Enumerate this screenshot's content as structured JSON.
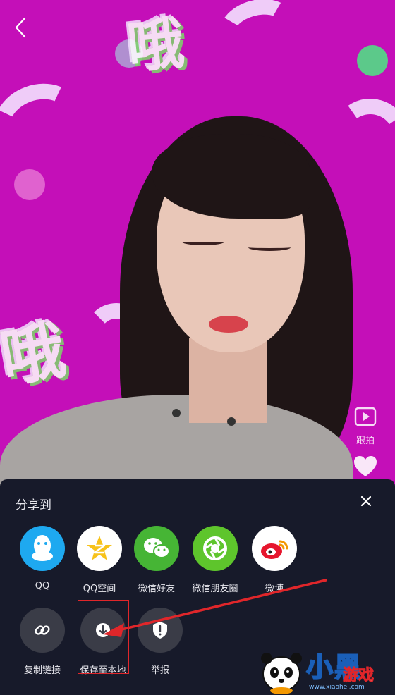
{
  "video": {
    "sticker_text": "哦",
    "rail": {
      "remix_label": "跟拍"
    }
  },
  "share_sheet": {
    "title": "分享到",
    "targets": [
      {
        "label": "QQ",
        "icon": "qq-penguin-icon",
        "color": "#1ea9f0"
      },
      {
        "label": "QQ空间",
        "icon": "qzone-star-icon",
        "color": "#ffffff"
      },
      {
        "label": "微信好友",
        "icon": "wechat-icon",
        "color": "#46b535"
      },
      {
        "label": "微信朋友圈",
        "icon": "moments-aperture-icon",
        "color": "#5ec52c"
      },
      {
        "label": "微博",
        "icon": "weibo-icon",
        "color": "#ffffff"
      }
    ],
    "actions": [
      {
        "label": "复制链接",
        "icon": "link-icon"
      },
      {
        "label": "保存至本地",
        "icon": "download-icon"
      },
      {
        "label": "举报",
        "icon": "report-shield-icon"
      }
    ]
  },
  "watermark": {
    "brand": "小黑",
    "tag": "游戏",
    "url": "www.xiaohei.com"
  },
  "colors": {
    "sheet_bg": "#171a2a",
    "highlight": "#e0262a",
    "video_bg": "#c40fb8"
  }
}
